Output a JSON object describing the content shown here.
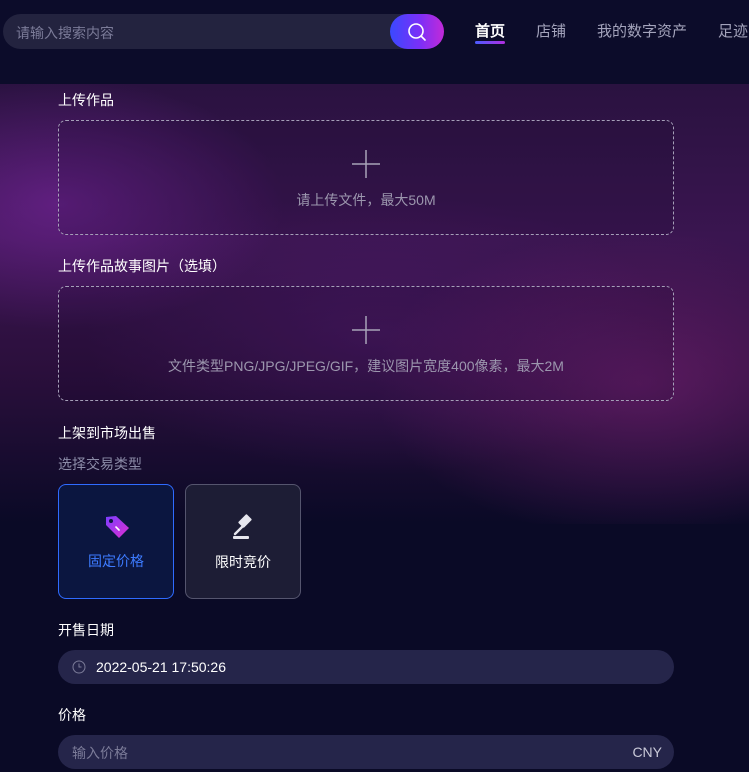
{
  "search": {
    "placeholder": "请输入搜索内容"
  },
  "nav": {
    "tabs": [
      {
        "label": "首页",
        "active": true
      },
      {
        "label": "店铺"
      },
      {
        "label": "我的数字资产"
      },
      {
        "label": "足迹"
      }
    ]
  },
  "upload_work": {
    "label": "上传作品",
    "hint": "请上传文件，最大50M"
  },
  "upload_story": {
    "label": "上传作品故事图片（选填）",
    "hint": "文件类型PNG/JPG/JPEG/GIF，建议图片宽度400像素，最大2M"
  },
  "market": {
    "label": "上架到市场出售",
    "sublabel": "选择交易类型",
    "types": [
      {
        "label": "固定价格",
        "icon": "price-tag-icon",
        "selected": true
      },
      {
        "label": "限时竞价",
        "icon": "auction-gavel-icon",
        "selected": false
      }
    ]
  },
  "sale_date": {
    "label": "开售日期",
    "value": "2022-05-21 17:50:26"
  },
  "price": {
    "label": "价格",
    "placeholder": "输入价格",
    "unit": "CNY"
  },
  "colors": {
    "accent": "#2f6bff",
    "gradient_start": "#3a49ff",
    "gradient_end": "#c22ad8"
  }
}
